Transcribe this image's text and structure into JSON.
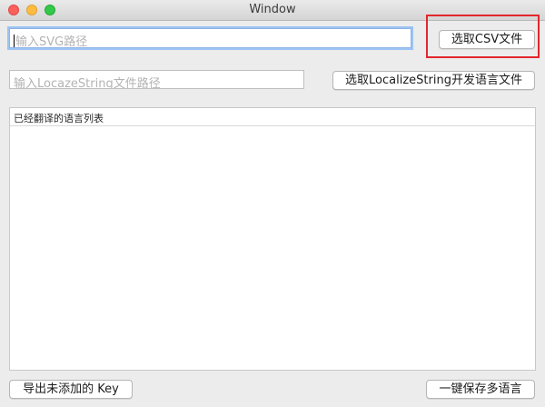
{
  "window": {
    "title": "Window",
    "controls": [
      "close",
      "minimize",
      "zoom"
    ]
  },
  "svg_path": {
    "placeholder": "输入SVG路径",
    "value": ""
  },
  "csv_button": {
    "label": "选取CSV文件"
  },
  "localize_path": {
    "placeholder": "输入LocazeString文件路径",
    "value": ""
  },
  "localize_button": {
    "label": "选取LocalizeString开发语言文件"
  },
  "languages_table": {
    "column_header": "已经翻译的语言列表",
    "rows": []
  },
  "export_button": {
    "label": "导出未添加的 Key"
  },
  "save_button": {
    "label": "一键保存多语言"
  },
  "colors": {
    "focus_ring": "#9cc4f3",
    "annotation_box": "#e3262d",
    "close": "#fc605c",
    "minimize": "#fdbc40",
    "zoom": "#34c84a"
  }
}
